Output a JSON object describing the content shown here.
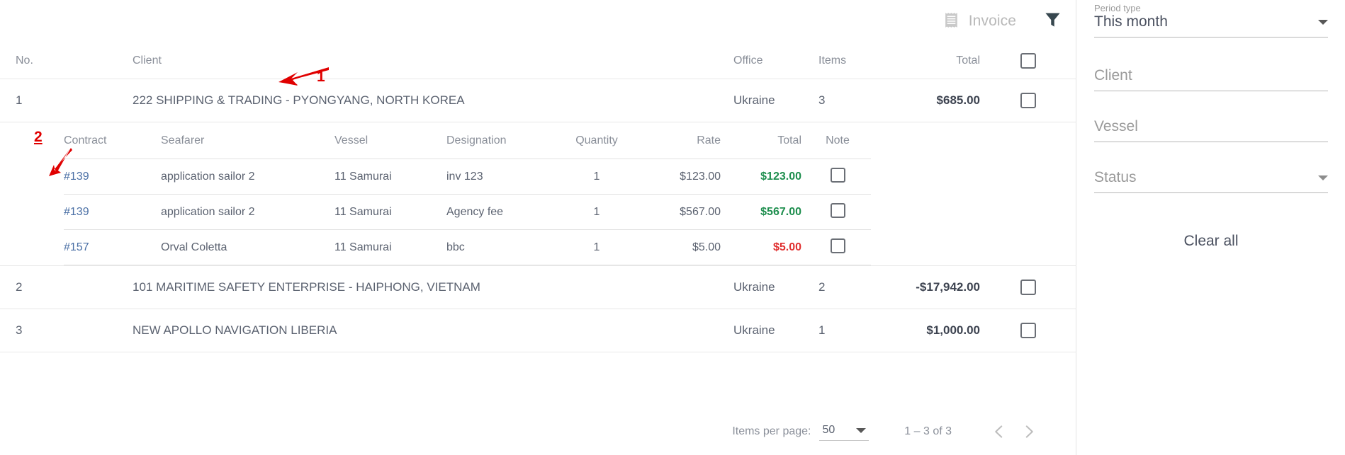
{
  "toolbar": {
    "invoice_label": "Invoice",
    "invoice_icon": "receipt-icon",
    "filter_icon": "filter-funnel-icon"
  },
  "table": {
    "headers": {
      "no": "No.",
      "client": "Client",
      "office": "Office",
      "items": "Items",
      "total": "Total"
    },
    "rows": [
      {
        "no": "1",
        "client": "222 SHIPPING & TRADING - PYONGYANG, NORTH KOREA",
        "office": "Ukraine",
        "items": "3",
        "total": "$685.00",
        "expanded": true
      },
      {
        "no": "2",
        "client": "101 MARITIME SAFETY ENTERPRISE - HAIPHONG, VIETNAM",
        "office": "Ukraine",
        "items": "2",
        "total": "-$17,942.00",
        "expanded": false
      },
      {
        "no": "3",
        "client": "NEW APOLLO NAVIGATION LIBERIA",
        "office": "Ukraine",
        "items": "1",
        "total": "$1,000.00",
        "expanded": false
      }
    ]
  },
  "subtable": {
    "headers": {
      "contract": "Contract",
      "seafarer": "Seafarer",
      "vessel": "Vessel",
      "designation": "Designation",
      "quantity": "Quantity",
      "rate": "Rate",
      "total": "Total",
      "note": "Note"
    },
    "rows": [
      {
        "contract": "#139",
        "seafarer": "application sailor 2",
        "vessel": "11 Samurai",
        "designation": "inv 123",
        "quantity": "1",
        "rate": "$123.00",
        "total": "$123.00",
        "total_sign": "positive"
      },
      {
        "contract": "#139",
        "seafarer": "application sailor 2",
        "vessel": "11 Samurai",
        "designation": "Agency fee",
        "quantity": "1",
        "rate": "$567.00",
        "total": "$567.00",
        "total_sign": "positive"
      },
      {
        "contract": "#157",
        "seafarer": "Orval Coletta",
        "vessel": "11 Samurai",
        "designation": "bbc",
        "quantity": "1",
        "rate": "$5.00",
        "total": "$5.00",
        "total_sign": "negative"
      }
    ]
  },
  "paginator": {
    "items_per_page_label": "Items per page:",
    "items_per_page_value": "50",
    "range_label": "1 – 3 of 3",
    "prev_icon": "chevron-left-icon",
    "next_icon": "chevron-right-icon"
  },
  "filters": {
    "period_type": {
      "label": "Period type",
      "value": "This month"
    },
    "client": {
      "placeholder": "Client"
    },
    "vessel": {
      "placeholder": "Vessel"
    },
    "status": {
      "placeholder": "Status"
    },
    "clear_all_label": "Clear all"
  },
  "annotations": [
    {
      "number": "1"
    },
    {
      "number": "2"
    }
  ],
  "colors": {
    "positive_amount": "#1e8e4e",
    "negative_amount": "#e03030",
    "link": "#4a6fa5",
    "annotation": "#e00000",
    "header_text": "#8a8f99",
    "body_text": "#5b6270"
  }
}
